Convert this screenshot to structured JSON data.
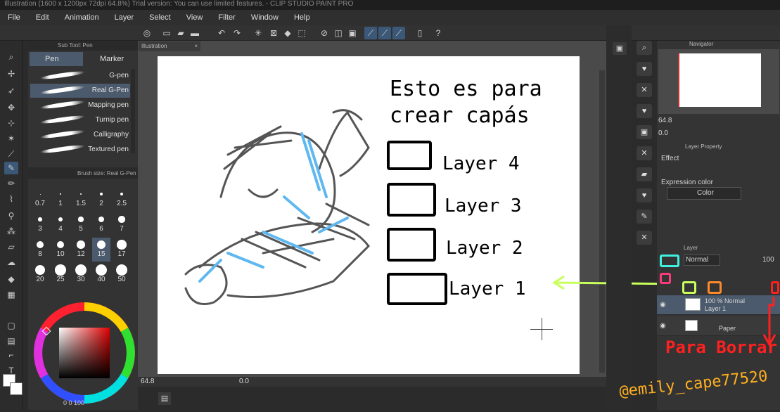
{
  "window": {
    "title": "Illustration (1600 x 1200px 72dpi 64.8%)  Trial version: You can use limited features. - CLIP STUDIO PAINT PRO"
  },
  "menu": [
    "File",
    "Edit",
    "Animation",
    "Layer",
    "Select",
    "View",
    "Filter",
    "Window",
    "Help"
  ],
  "subtool": {
    "header": "Sub Tool: Pen",
    "tabs": [
      "Pen",
      "Marker"
    ],
    "brushes": [
      "G-pen",
      "Real G-Pen",
      "Mapping pen",
      "Turnip pen",
      "Calligraphy",
      "Textured pen"
    ],
    "selected_index": 1
  },
  "brush_size": {
    "header": "Brush size: Real G-Pen",
    "values": [
      "0.7",
      "1",
      "1.5",
      "2",
      "2.5",
      "3",
      "4",
      "5",
      "6",
      "7",
      "8",
      "10",
      "12",
      "15",
      "17",
      "20",
      "25",
      "30",
      "40",
      "50"
    ],
    "selected": "15"
  },
  "document": {
    "tab": "Illustration"
  },
  "canvas_text": {
    "title_line1": "Esto es para",
    "title_line2": "crear capás",
    "layers": [
      "Layer 4",
      "Layer 3",
      "Layer 2",
      "Layer 1"
    ]
  },
  "status": {
    "zoom": "64.8",
    "angle": "0.0"
  },
  "navigator": {
    "label": "Navigator",
    "zoom": "64.8",
    "angle": "0.0"
  },
  "layer_property": {
    "label": "Layer Property",
    "effect_label": "Effect",
    "expression_label": "Expression color",
    "expression_value": "Color"
  },
  "layer_panel": {
    "label": "Layer",
    "blend_mode": "Normal",
    "opacity": "100",
    "layers": [
      {
        "line1": "100 % Normal",
        "line2": "Layer 1"
      },
      {
        "line1": "Paper",
        "line2": ""
      }
    ]
  },
  "annotations": {
    "delete_label": "Para Borrar",
    "watermark": "@emily_cape77520"
  },
  "colors": {
    "accent_select": "#3c5878",
    "cyan_mark": "#3ff0e0",
    "green_mark": "#c8ff5a",
    "orange_mark": "#ff8a2a",
    "pink_mark": "#ff3a7a",
    "red_mark": "#ff2020",
    "watermark": "#ffb020"
  },
  "footer": {
    "counts": "0 0 100"
  }
}
